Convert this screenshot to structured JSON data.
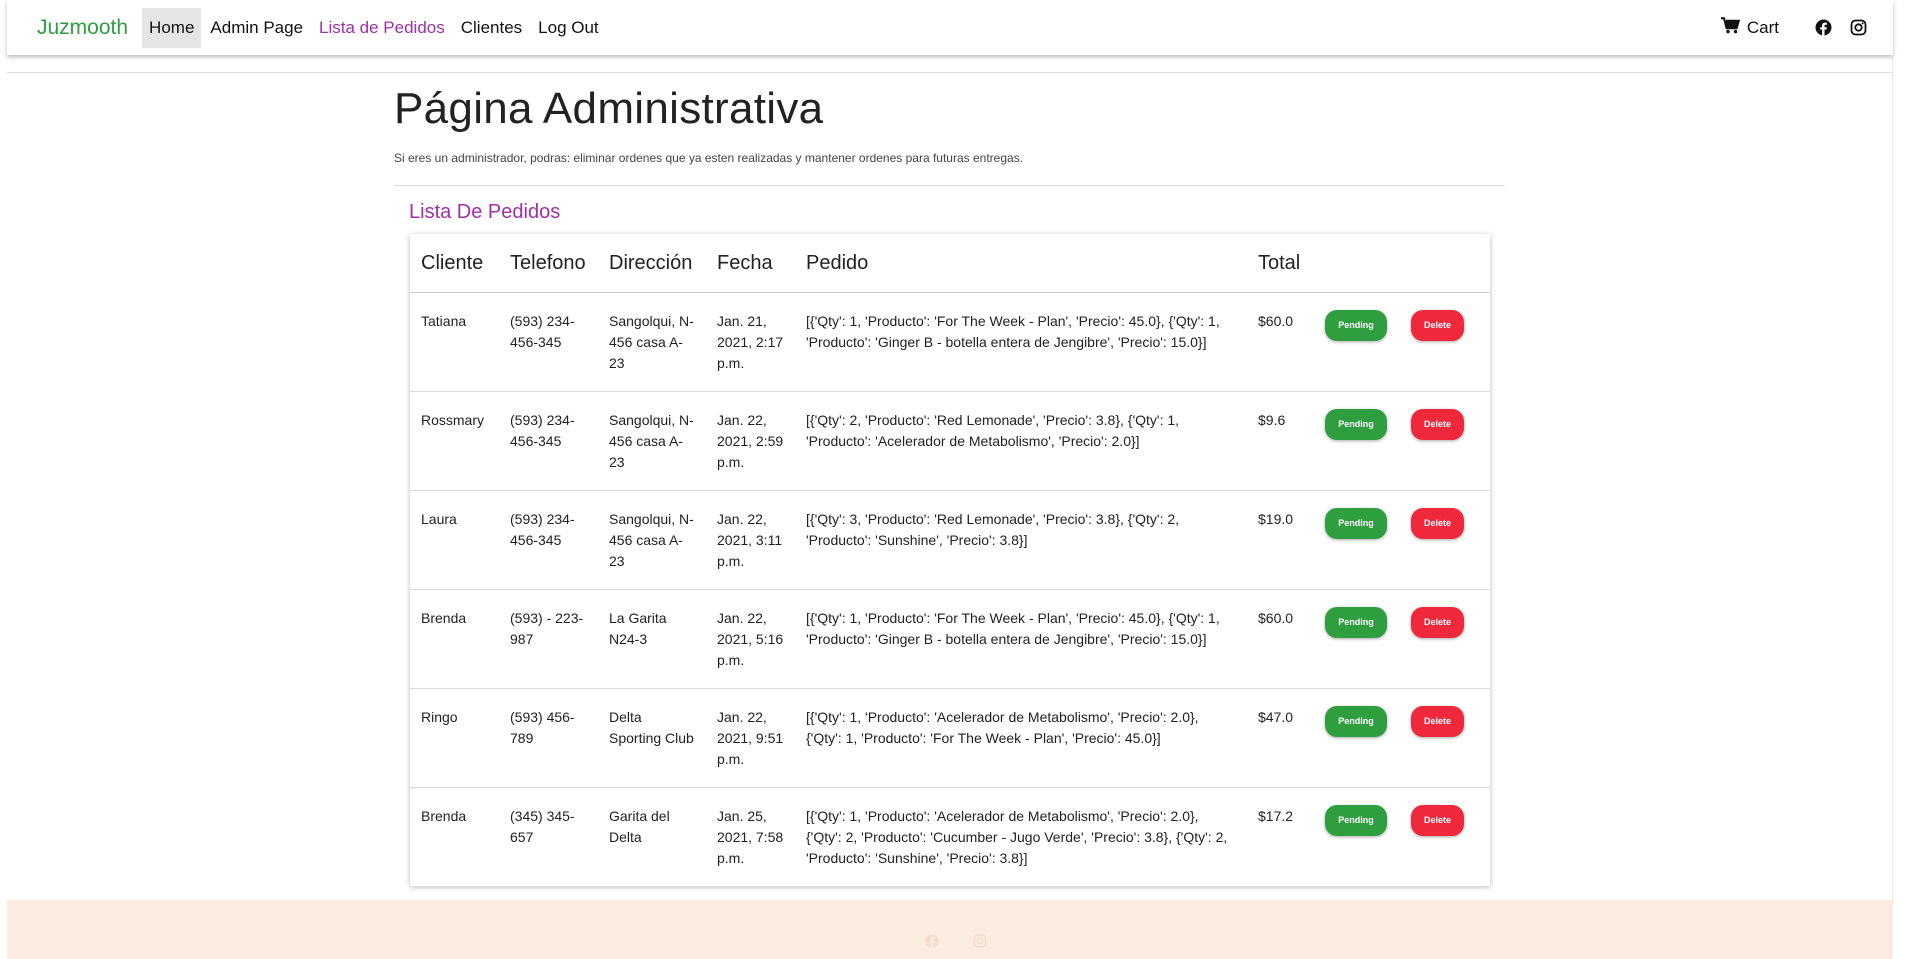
{
  "nav": {
    "brand": "Juzmooth",
    "links": [
      "Home",
      "Admin Page",
      "Lista de Pedidos",
      "Clientes",
      "Log Out"
    ],
    "cart": "Cart"
  },
  "page": {
    "title": "Página Administrativa",
    "description": "Si eres un administrador, podras: eliminar ordenes que ya esten realizadas y mantener ordenes para futuras entregas."
  },
  "orders": {
    "title": "Lista De Pedidos",
    "headers": [
      "Cliente",
      "Telefono",
      "Dirección",
      "Fecha",
      "Pedido",
      "Total"
    ],
    "pending_label": "Pending",
    "delete_label": "Delete",
    "rows": [
      {
        "cliente": "Tatiana",
        "telefono": "(593) 234-456-345",
        "direccion": "Sangolqui, N-456 casa A-23",
        "fecha": "Jan. 21, 2021, 2:17 p.m.",
        "pedido": "[{'Qty': 1, 'Producto': 'For The Week - Plan', 'Precio': 45.0}, {'Qty': 1, 'Producto': 'Ginger B - botella entera de Jengibre', 'Precio': 15.0}]",
        "total": "$60.0"
      },
      {
        "cliente": "Rossmary",
        "telefono": "(593) 234-456-345",
        "direccion": "Sangolqui, N-456 casa A-23",
        "fecha": "Jan. 22, 2021, 2:59 p.m.",
        "pedido": "[{'Qty': 2, 'Producto': 'Red Lemonade', 'Precio': 3.8}, {'Qty': 1, 'Producto': 'Acelerador de Metabolismo', 'Precio': 2.0}]",
        "total": "$9.6"
      },
      {
        "cliente": "Laura",
        "telefono": "(593) 234-456-345",
        "direccion": "Sangolqui, N-456 casa A-23",
        "fecha": "Jan. 22, 2021, 3:11 p.m.",
        "pedido": "[{'Qty': 3, 'Producto': 'Red Lemonade', 'Precio': 3.8}, {'Qty': 2, 'Producto': 'Sunshine', 'Precio': 3.8}]",
        "total": "$19.0"
      },
      {
        "cliente": "Brenda",
        "telefono": "(593) - 223-987",
        "direccion": "La Garita N24-3",
        "fecha": "Jan. 22, 2021, 5:16 p.m.",
        "pedido": "[{'Qty': 1, 'Producto': 'For The Week - Plan', 'Precio': 45.0}, {'Qty': 1, 'Producto': 'Ginger B - botella entera de Jengibre', 'Precio': 15.0}]",
        "total": "$60.0"
      },
      {
        "cliente": "Ringo",
        "telefono": "(593) 456-789",
        "direccion": "Delta Sporting Club",
        "fecha": "Jan. 22, 2021, 9:51 p.m.",
        "pedido": "[{'Qty': 1, 'Producto': 'Acelerador de Metabolismo', 'Precio': 2.0}, {'Qty': 1, 'Producto': 'For The Week - Plan', 'Precio': 45.0}]",
        "total": "$47.0"
      },
      {
        "cliente": "Brenda",
        "telefono": "(345) 345-657",
        "direccion": "Garita del Delta",
        "fecha": "Jan. 25, 2021, 7:58 p.m.",
        "pedido": "[{'Qty': 1, 'Producto': 'Acelerador de Metabolismo', 'Precio': 2.0}, {'Qty': 2, 'Producto': 'Cucumber - Jugo Verde', 'Precio': 3.8}, {'Qty': 2, 'Producto': 'Sunshine', 'Precio': 3.8}]",
        "total": "$17.2"
      }
    ]
  },
  "colors": {
    "brand": "#2e9e3f",
    "accent": "#a02fa8",
    "pending": "#2e9e3f",
    "delete": "#f0283c",
    "footer": "#fbece0"
  },
  "icons": [
    "cart-icon",
    "facebook-icon",
    "instagram-icon"
  ]
}
